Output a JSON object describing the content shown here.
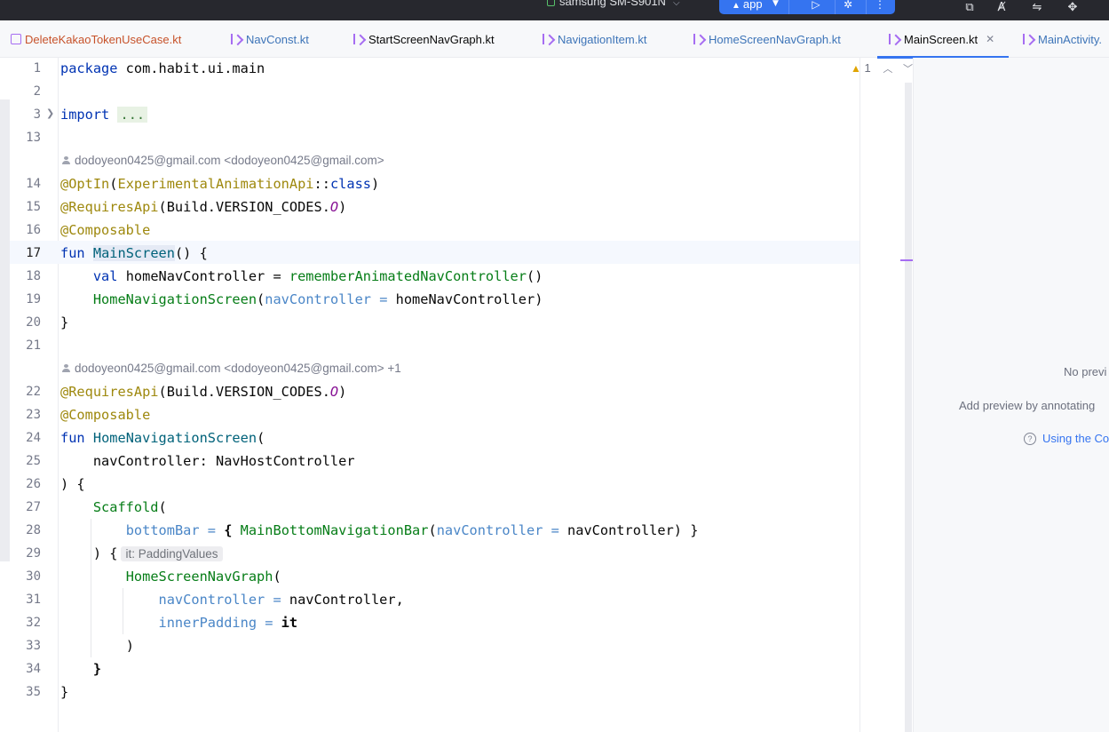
{
  "toolbar": {
    "device": "samsung SM-S901N",
    "run_config": "app"
  },
  "tabs": [
    {
      "label": "DeleteKakaoTokenUseCase.kt"
    },
    {
      "label": "NavConst.kt"
    },
    {
      "label": "StartScreenNavGraph.kt"
    },
    {
      "label": "NavigationItem.kt"
    },
    {
      "label": "HomeScreenNavGraph.kt"
    },
    {
      "label": "MainScreen.kt",
      "active": true
    },
    {
      "label": "MainActivity."
    }
  ],
  "editor": {
    "warnings_count": "1",
    "line_numbers": [
      "1",
      "2",
      "3",
      "13",
      "14",
      "15",
      "16",
      "17",
      "18",
      "19",
      "20",
      "21",
      "22",
      "23",
      "24",
      "25",
      "26",
      "27",
      "28",
      "29",
      "30",
      "31",
      "32",
      "33",
      "34",
      "35"
    ],
    "current_line": "17",
    "author1": "dodoyeon0425@gmail.com <dodoyeon0425@gmail.com>",
    "author2": "dodoyeon0425@gmail.com <dodoyeon0425@gmail.com> +1",
    "hint_it": "it: PaddingValues",
    "code": {
      "l1_kw": "package",
      "l1_rest": " com.habit.ui.main",
      "l3_kw": "import",
      "l3_fold": "...",
      "l14_ann": "@OptIn",
      "l14_a": "(",
      "l14_b": "ExperimentalAnimationApi",
      "l14_c": "::",
      "l14_d": "class",
      "l14_e": ")",
      "l15_ann": "@RequiresApi",
      "l15_a": "(Build.VERSION_CODES.",
      "l15_b": "O",
      "l15_c": ")",
      "l16_ann": "@Composable",
      "l17_kw": "fun",
      "l17_name": "MainScreen",
      "l17_rest": "() {",
      "l18_kw": "val",
      "l18_a": " homeNavController = ",
      "l18_call": "rememberAnimatedNavController",
      "l18_b": "()",
      "l19_call": "HomeNavigationScreen",
      "l19_a": "(",
      "l19_param": "navController =",
      "l19_b": " homeNavController)",
      "l20": "}",
      "l22_ann": "@RequiresApi",
      "l22_a": "(Build.VERSION_CODES.",
      "l22_b": "O",
      "l22_c": ")",
      "l23_ann": "@Composable",
      "l24_kw": "fun",
      "l24_name": "HomeNavigationScreen",
      "l24_rest": "(",
      "l25": "navController: NavHostController",
      "l26": ") {",
      "l27_call": "Scaffold",
      "l27_rest": "(",
      "l28_param": "bottomBar =",
      "l28_a": " { ",
      "l28_call": "MainBottomNavigationBar",
      "l28_b": "(",
      "l28_param2": "navController =",
      "l28_c": " navController) }",
      "l29": ") {",
      "l30_call": "HomeScreenNavGraph",
      "l30_rest": "(",
      "l31_param": "navController =",
      "l31_rest": " navController,",
      "l32_param": "innerPadding =",
      "l32_it": "it",
      "l33": ")",
      "l34": "}",
      "l35": "}"
    }
  },
  "preview": {
    "no_preview": "No previ",
    "add_preview": "Add preview by annotating",
    "using": "Using the Co"
  }
}
